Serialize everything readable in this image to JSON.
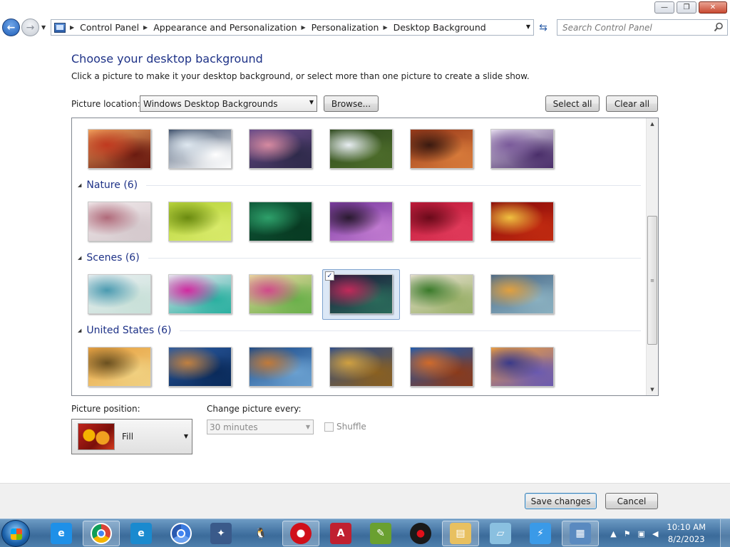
{
  "window": {
    "minimize_glyph": "—",
    "maximize_glyph": "❐",
    "close_glyph": "✕"
  },
  "navigation": {
    "back_icon": "back-arrow-icon",
    "forward_icon": "forward-arrow-icon",
    "breadcrumbs": [
      "Control Panel",
      "Appearance and Personalization",
      "Personalization",
      "Desktop Background"
    ],
    "search_placeholder": "Search Control Panel"
  },
  "page": {
    "heading": "Choose your desktop background",
    "subtext": "Click a picture to make it your desktop background, or select more than one picture to create a slide show.",
    "picture_location_label": "Picture location:",
    "picture_location_value": "Windows Desktop Backgrounds",
    "browse_label": "Browse...",
    "select_all_label": "Select all",
    "clear_all_label": "Clear all"
  },
  "gallery": {
    "groups": [
      {
        "label": "",
        "header_visible": false,
        "thumbnails": [
          {
            "name": "red-canyon",
            "selected": false,
            "colors": [
              "#f2a35e",
              "#c0391f",
              "#6a1a10"
            ]
          },
          {
            "name": "ice-lake",
            "selected": false,
            "colors": [
              "#3d4f6a",
              "#dfe8f0",
              "#ffffff"
            ]
          },
          {
            "name": "purple-coast",
            "selected": false,
            "colors": [
              "#6a4c8a",
              "#d68aa0",
              "#2e2a4a"
            ]
          },
          {
            "name": "waterfall",
            "selected": false,
            "colors": [
              "#2f4a1e",
              "#e8eef2",
              "#4c6b2a"
            ]
          },
          {
            "name": "stone-arch",
            "selected": false,
            "colors": [
              "#9a3a1a",
              "#3a1a10",
              "#d77a3a"
            ]
          },
          {
            "name": "lavender-field",
            "selected": false,
            "colors": [
              "#e8e0f0",
              "#7a5a9a",
              "#4a2e6a"
            ]
          }
        ]
      },
      {
        "label": "Nature (6)",
        "header_visible": true,
        "thumbnails": [
          {
            "name": "frost-needles",
            "selected": false,
            "colors": [
              "#f0e8ea",
              "#b06a7a",
              "#d4c8cc"
            ]
          },
          {
            "name": "succulent",
            "selected": false,
            "colors": [
              "#b8d43a",
              "#6a8a10",
              "#d8ea6a"
            ]
          },
          {
            "name": "green-leaves",
            "selected": false,
            "colors": [
              "#0f5a3a",
              "#2ea06a",
              "#083a22"
            ]
          },
          {
            "name": "thistle",
            "selected": false,
            "colors": [
              "#7a3aa0",
              "#2a1a30",
              "#c07ad0"
            ]
          },
          {
            "name": "dahlia",
            "selected": false,
            "colors": [
              "#c01a3a",
              "#6a0a1a",
              "#e03a5a"
            ]
          },
          {
            "name": "autumn-leaves",
            "selected": false,
            "colors": [
              "#8a0a0a",
              "#f0c040",
              "#c02a10"
            ]
          }
        ]
      },
      {
        "label": "Scenes (6)",
        "header_visible": true,
        "thumbnails": [
          {
            "name": "blue-sketch",
            "selected": false,
            "colors": [
              "#e8eef0",
              "#4a9ab0",
              "#c8e0d8"
            ]
          },
          {
            "name": "colorful-flora",
            "selected": false,
            "colors": [
              "#e8e8f0",
              "#d02aa0",
              "#2ab0a0"
            ]
          },
          {
            "name": "orbs",
            "selected": false,
            "colors": [
              "#e8d8a0",
              "#d04a8a",
              "#6ab04a"
            ]
          },
          {
            "name": "night-bokeh",
            "selected": true,
            "colors": [
              "#1a1a3a",
              "#c02a5a",
              "#2a6a5a"
            ]
          },
          {
            "name": "meadow",
            "selected": false,
            "colors": [
              "#e8e0d0",
              "#3a7a2a",
              "#9ab06a"
            ]
          },
          {
            "name": "abstract-shapes",
            "selected": false,
            "colors": [
              "#4a6a8a",
              "#e0a040",
              "#8ab0c0"
            ]
          }
        ]
      },
      {
        "label": "United States (6)",
        "header_visible": true,
        "thumbnails": [
          {
            "name": "prairie-sunset",
            "selected": false,
            "colors": [
              "#e8a040",
              "#6a5020",
              "#f0d080"
            ]
          },
          {
            "name": "lighthouse",
            "selected": false,
            "colors": [
              "#2a5aa0",
              "#c08040",
              "#0a2a5a"
            ]
          },
          {
            "name": "sea-rock",
            "selected": false,
            "colors": [
              "#1a4a8a",
              "#c07a3a",
              "#6aa0d0"
            ]
          },
          {
            "name": "hay-bale",
            "selected": false,
            "colors": [
              "#2a4a8a",
              "#d0a040",
              "#8a6020"
            ]
          },
          {
            "name": "delicate-arch",
            "selected": false,
            "colors": [
              "#1a5ab0",
              "#d06a2a",
              "#8a3a1a"
            ]
          },
          {
            "name": "lupine-lake",
            "selected": false,
            "colors": [
              "#f0a040",
              "#3a3a8a",
              "#6a5ab0"
            ]
          }
        ]
      }
    ]
  },
  "options": {
    "picture_position_label": "Picture position:",
    "picture_position_value": "Fill",
    "change_every_label": "Change picture every:",
    "change_every_value": "30 minutes",
    "change_every_enabled": false,
    "shuffle_label": "Shuffle",
    "shuffle_checked": false,
    "shuffle_enabled": false
  },
  "footer": {
    "save_label": "Save changes",
    "cancel_label": "Cancel"
  },
  "taskbar": {
    "apps": [
      {
        "name": "internet-explorer",
        "glyph": "e",
        "color": "#1e90e8",
        "active": false
      },
      {
        "name": "chrome",
        "glyph": "",
        "color": "#ffffff",
        "active": true
      },
      {
        "name": "edge",
        "glyph": "e",
        "color": "#1a8acf",
        "active": false
      },
      {
        "name": "chromium",
        "glyph": "",
        "color": "#3a7ae0",
        "active": false
      },
      {
        "name": "bug-tool",
        "glyph": "✦",
        "color": "#3a5a8a",
        "active": false
      },
      {
        "name": "penguin",
        "glyph": "🐧",
        "color": "transparent",
        "active": false
      },
      {
        "name": "opera",
        "glyph": "O",
        "color": "#d0101a",
        "active": true
      },
      {
        "name": "archive-app",
        "glyph": "A",
        "color": "#c02030",
        "active": false
      },
      {
        "name": "notepad-plus",
        "glyph": "✎",
        "color": "#6aa030",
        "active": false
      },
      {
        "name": "record-app",
        "glyph": "●",
        "color": "#1a1a1a",
        "active": false
      },
      {
        "name": "file-explorer",
        "glyph": "▤",
        "color": "#e8c060",
        "active": true
      },
      {
        "name": "notepad",
        "glyph": "▱",
        "color": "#8ac0e0",
        "active": false
      },
      {
        "name": "lightning-app",
        "glyph": "⚡",
        "color": "#3a9ae8",
        "active": false
      },
      {
        "name": "control-panel",
        "glyph": "▦",
        "color": "#5a8ac0",
        "active": true
      }
    ],
    "time": "10:10 AM",
    "date": "8/2/2023"
  }
}
